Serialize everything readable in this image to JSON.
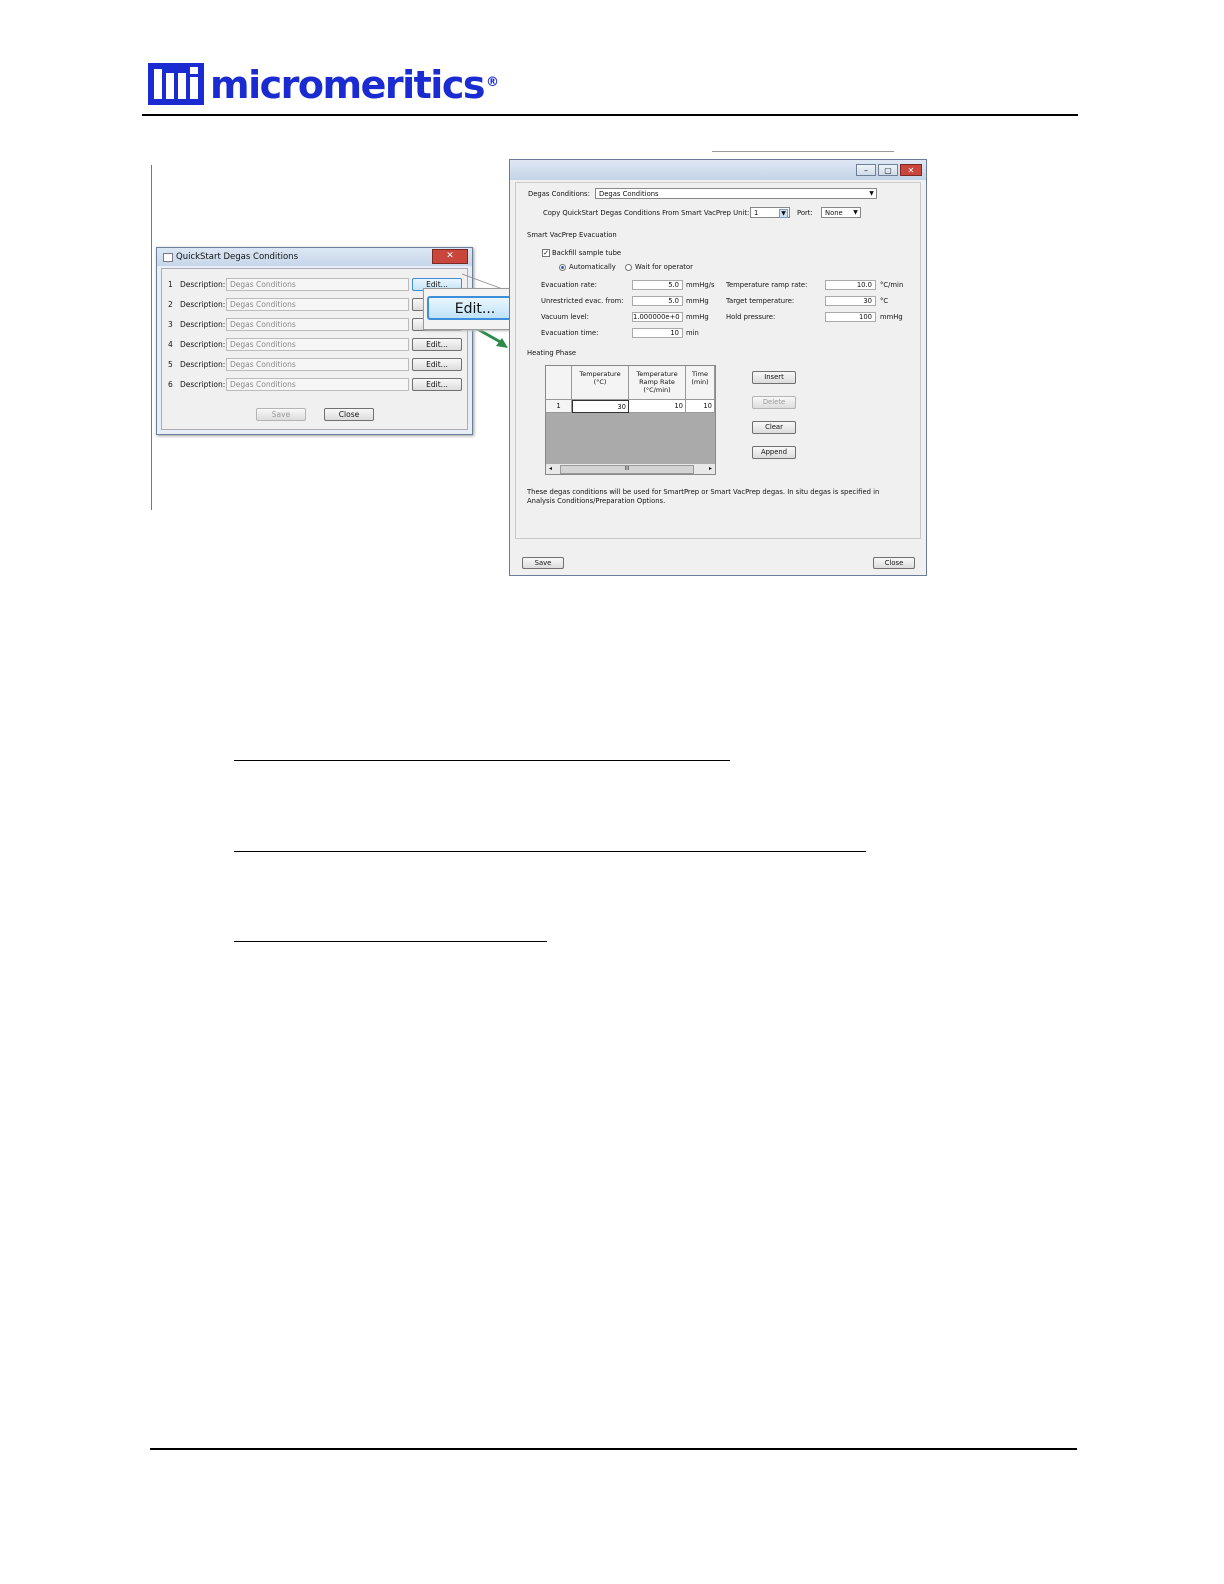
{
  "logo": {
    "text": "micromeritics",
    "reg": "®",
    "mark": "mi"
  },
  "quickstart": {
    "title": "QuickStart Degas Conditions",
    "close_glyph": "✕",
    "rows": [
      {
        "num": "1",
        "label": "Description:",
        "value": "Degas Conditions",
        "button": "Edit..."
      },
      {
        "num": "2",
        "label": "Description:",
        "value": "Degas Conditions",
        "button": "Edit..."
      },
      {
        "num": "3",
        "label": "Description:",
        "value": "Degas Conditions",
        "button": "Edit..."
      },
      {
        "num": "4",
        "label": "Description:",
        "value": "Degas Conditions",
        "button": "Edit..."
      },
      {
        "num": "5",
        "label": "Description:",
        "value": "Degas Conditions",
        "button": "Edit..."
      },
      {
        "num": "6",
        "label": "Description:",
        "value": "Degas Conditions",
        "button": "Edit..."
      }
    ],
    "save": "Save",
    "close": "Close"
  },
  "callout": {
    "label": "Edit..."
  },
  "degas": {
    "minimize": "–",
    "restore": "▢",
    "close_glyph": "✕",
    "conditions_label": "Degas Conditions:",
    "conditions_value": "Degas Conditions",
    "copy_label": "Copy QuickStart Degas Conditions From Smart VacPrep Unit:",
    "copy_unit": "1",
    "port_label": "Port:",
    "port_value": "None",
    "section_evac": "Smart VacPrep Evacuation",
    "backfill_label": "Backfill sample tube",
    "radio_auto": "Automatically",
    "radio_wait": "Wait for operator",
    "evac_rate_label": "Evacuation rate:",
    "evac_rate": "5.0",
    "evac_rate_unit": "mmHg/s",
    "unrestricted_label": "Unrestricted evac. from:",
    "unrestricted": "5.0",
    "unrestricted_unit": "mmHg",
    "vacuum_label": "Vacuum level:",
    "vacuum": "1.000000e+0",
    "vacuum_unit": "mmHg",
    "evac_time_label": "Evacuation time:",
    "evac_time": "10",
    "evac_time_unit": "min",
    "ramp_label": "Temperature ramp rate:",
    "ramp": "10.0",
    "ramp_unit": "°C/min",
    "target_label": "Target temperature:",
    "target": "30",
    "target_unit": "°C",
    "hold_label": "Hold pressure:",
    "hold": "100",
    "hold_unit": "mmHg",
    "section_heating": "Heating Phase",
    "table": {
      "headers": [
        "Temperature (°C)",
        "Temperature Ramp Rate (°C/min)",
        "Time (min)"
      ],
      "rows": [
        {
          "num": "1",
          "temp": "30",
          "rate": "10",
          "time": "10"
        }
      ]
    },
    "scroll_mid": "III",
    "insert": "Insert",
    "delete": "Delete",
    "clear": "Clear",
    "append": "Append",
    "note": "These degas conditions will be used for SmartPrep or Smart VacPrep degas. In situ degas is specified in Analysis Conditions/Preparation Options.",
    "save": "Save",
    "close": "Close"
  }
}
